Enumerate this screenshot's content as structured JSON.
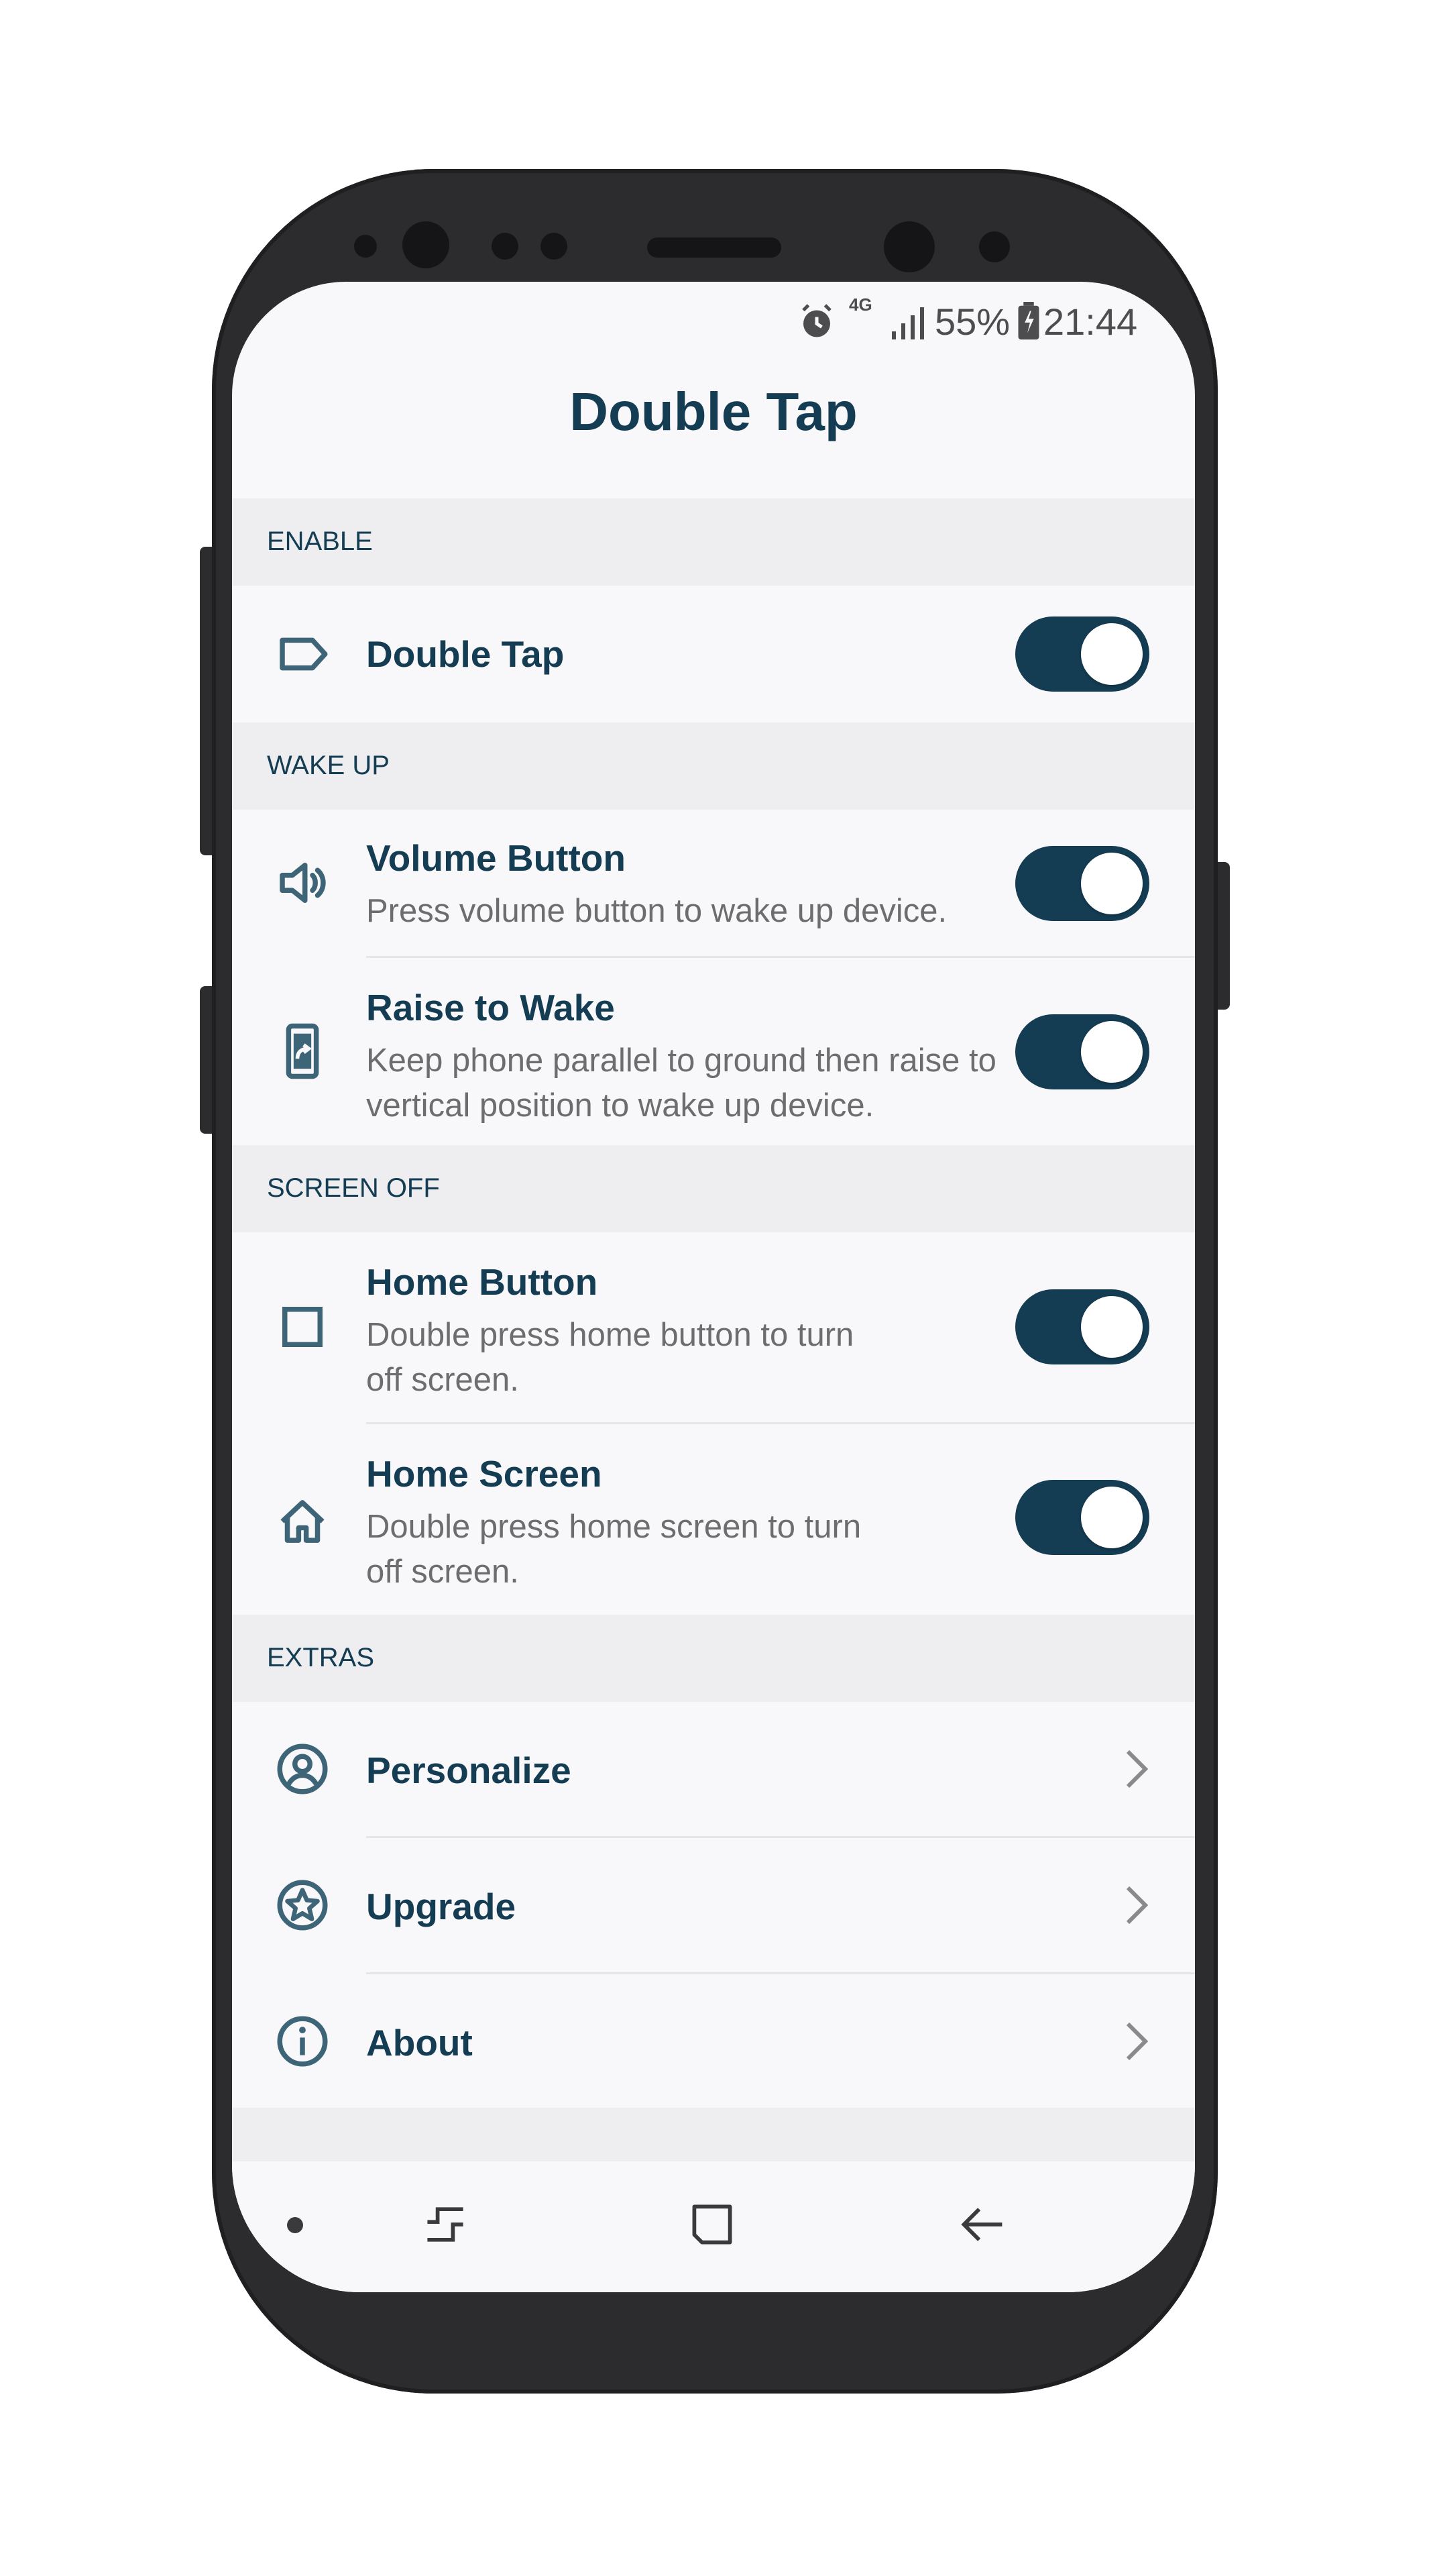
{
  "status_bar": {
    "network": "4G",
    "battery_percent": "55%",
    "time": "21:44",
    "icons": [
      "alarm-icon",
      "signal-icon",
      "battery-charging-icon"
    ]
  },
  "title": "Double Tap",
  "sections": {
    "enable": {
      "header": "ENABLE",
      "items": [
        {
          "title": "Double Tap",
          "icon": "label-tag-icon",
          "enabled": true
        }
      ]
    },
    "wake_up": {
      "header": "WAKE UP",
      "items": [
        {
          "title": "Volume Button",
          "description": "Press volume button to wake up device.",
          "icon": "volume-icon",
          "enabled": true
        },
        {
          "title": "Raise to Wake",
          "description_line1": "Keep phone parallel to ground then raise to",
          "description_line2": "vertical position to wake up device.",
          "icon": "phone-raise-icon",
          "enabled": true
        }
      ]
    },
    "screen_off": {
      "header": "SCREEN OFF",
      "items": [
        {
          "title": "Home Button",
          "description_line1": "Double press home button to turn",
          "description_line2": "off screen.",
          "icon": "square-icon",
          "enabled": true
        },
        {
          "title": "Home Screen",
          "description_line1": "Double press home screen to turn",
          "description_line2": "off screen.",
          "icon": "home-icon",
          "enabled": true
        }
      ]
    },
    "extras": {
      "header": "EXTRAS",
      "items": [
        {
          "title": "Personalize",
          "icon": "user-circle-icon"
        },
        {
          "title": "Upgrade",
          "icon": "star-circle-icon"
        },
        {
          "title": "About",
          "icon": "info-icon"
        }
      ]
    }
  },
  "nav_bar": {
    "icons": [
      "dot-icon",
      "recents-icon",
      "home-nav-icon",
      "back-icon"
    ]
  },
  "colors": {
    "primary": "#143c53",
    "icon": "#3e6478",
    "background": "#f8f7f9",
    "section_bg": "#eeedf0",
    "description": "#6d6d70"
  }
}
